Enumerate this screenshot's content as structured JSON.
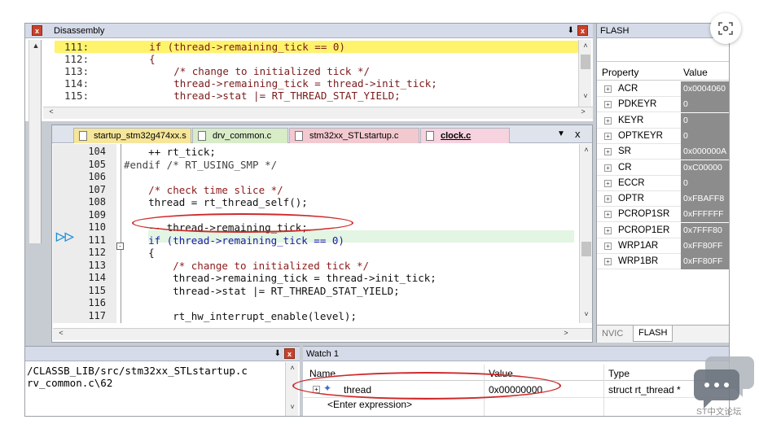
{
  "disassembly": {
    "title": "Disassembly",
    "close": "x",
    "lines": [
      {
        "num": "111:",
        "code": "    if (thread->remaining_tick == 0)"
      },
      {
        "num": "112:",
        "code": "    {"
      },
      {
        "num": "113:",
        "code": "        /* change to initialized tick */"
      },
      {
        "num": "114:",
        "code": "        thread->remaining_tick = thread->init_tick;"
      },
      {
        "num": "115:",
        "code": "        thread->stat |= RT_THREAD_STAT_YIELD;"
      }
    ]
  },
  "editor": {
    "tabs": [
      {
        "label": "startup_stm32g474xx.s"
      },
      {
        "label": "drv_common.c"
      },
      {
        "label": "stm32xx_STLstartup.c"
      },
      {
        "label": "clock.c"
      }
    ],
    "close": "x",
    "lines": [
      {
        "num": "104",
        "code": "    ++ rt_tick;"
      },
      {
        "num": "105",
        "code": "#endif /* RT_USING_SMP */"
      },
      {
        "num": "106",
        "code": ""
      },
      {
        "num": "107",
        "code": "    /* check time slice */"
      },
      {
        "num": "108",
        "code": "    thread = rt_thread_self();"
      },
      {
        "num": "109",
        "code": ""
      },
      {
        "num": "110",
        "code": "    -- thread->remaining_tick;"
      },
      {
        "num": "111",
        "code": "    if (thread->remaining_tick == 0)"
      },
      {
        "num": "112",
        "code": "    {"
      },
      {
        "num": "113",
        "code": "        /* change to initialized tick */"
      },
      {
        "num": "114",
        "code": "        thread->remaining_tick = thread->init_tick;"
      },
      {
        "num": "115",
        "code": "        thread->stat |= RT_THREAD_STAT_YIELD;"
      },
      {
        "num": "116",
        "code": ""
      },
      {
        "num": "117",
        "code": "        rt_hw_interrupt_enable(level);"
      }
    ]
  },
  "flash": {
    "title": "FLASH",
    "col_property": "Property",
    "col_value": "Value",
    "rows": [
      {
        "name": "ACR",
        "value": "0x0004060"
      },
      {
        "name": "PDKEYR",
        "value": "0"
      },
      {
        "name": "KEYR",
        "value": "0"
      },
      {
        "name": "OPTKEYR",
        "value": "0"
      },
      {
        "name": "SR",
        "value": "0x000000A"
      },
      {
        "name": "CR",
        "value": "0xC00000"
      },
      {
        "name": "ECCR",
        "value": "0"
      },
      {
        "name": "OPTR",
        "value": "0xFBAFF8"
      },
      {
        "name": "PCROP1SR",
        "value": "0xFFFFFF"
      },
      {
        "name": "PCROP1ER",
        "value": "0x7FFF80"
      },
      {
        "name": "WRP1AR",
        "value": "0xFF80FF"
      },
      {
        "name": "WRP1BR",
        "value": "0xFF80FF"
      }
    ],
    "tabs": [
      {
        "label": "NVIC"
      },
      {
        "label": "FLASH"
      }
    ]
  },
  "callstack": {
    "lines": [
      "/CLASSB_LIB/src/stm32xx_STLstartup.c",
      "rv_common.c\\62"
    ]
  },
  "watch": {
    "title": "Watch 1",
    "col_name": "Name",
    "col_value": "Value",
    "col_type": "Type",
    "row": {
      "name": "thread",
      "value": "0x00000000",
      "type": "struct rt_thread *"
    },
    "enter_placeholder": "<Enter expression>"
  },
  "watermark": "ST中文论坛"
}
